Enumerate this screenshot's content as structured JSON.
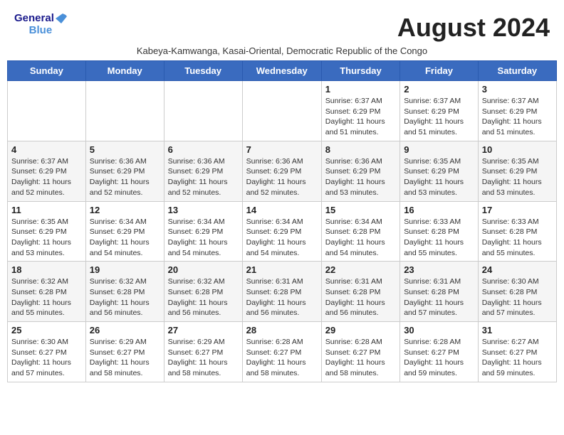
{
  "header": {
    "logo_general": "General",
    "logo_blue": "Blue",
    "month_year": "August 2024",
    "subtitle": "Kabeya-Kamwanga, Kasai-Oriental, Democratic Republic of the Congo"
  },
  "days_of_week": [
    "Sunday",
    "Monday",
    "Tuesday",
    "Wednesday",
    "Thursday",
    "Friday",
    "Saturday"
  ],
  "weeks": [
    [
      {
        "day": "",
        "info": ""
      },
      {
        "day": "",
        "info": ""
      },
      {
        "day": "",
        "info": ""
      },
      {
        "day": "",
        "info": ""
      },
      {
        "day": "1",
        "info": "Sunrise: 6:37 AM\nSunset: 6:29 PM\nDaylight: 11 hours and 51 minutes."
      },
      {
        "day": "2",
        "info": "Sunrise: 6:37 AM\nSunset: 6:29 PM\nDaylight: 11 hours and 51 minutes."
      },
      {
        "day": "3",
        "info": "Sunrise: 6:37 AM\nSunset: 6:29 PM\nDaylight: 11 hours and 51 minutes."
      }
    ],
    [
      {
        "day": "4",
        "info": "Sunrise: 6:37 AM\nSunset: 6:29 PM\nDaylight: 11 hours and 52 minutes."
      },
      {
        "day": "5",
        "info": "Sunrise: 6:36 AM\nSunset: 6:29 PM\nDaylight: 11 hours and 52 minutes."
      },
      {
        "day": "6",
        "info": "Sunrise: 6:36 AM\nSunset: 6:29 PM\nDaylight: 11 hours and 52 minutes."
      },
      {
        "day": "7",
        "info": "Sunrise: 6:36 AM\nSunset: 6:29 PM\nDaylight: 11 hours and 52 minutes."
      },
      {
        "day": "8",
        "info": "Sunrise: 6:36 AM\nSunset: 6:29 PM\nDaylight: 11 hours and 53 minutes."
      },
      {
        "day": "9",
        "info": "Sunrise: 6:35 AM\nSunset: 6:29 PM\nDaylight: 11 hours and 53 minutes."
      },
      {
        "day": "10",
        "info": "Sunrise: 6:35 AM\nSunset: 6:29 PM\nDaylight: 11 hours and 53 minutes."
      }
    ],
    [
      {
        "day": "11",
        "info": "Sunrise: 6:35 AM\nSunset: 6:29 PM\nDaylight: 11 hours and 53 minutes."
      },
      {
        "day": "12",
        "info": "Sunrise: 6:34 AM\nSunset: 6:29 PM\nDaylight: 11 hours and 54 minutes."
      },
      {
        "day": "13",
        "info": "Sunrise: 6:34 AM\nSunset: 6:29 PM\nDaylight: 11 hours and 54 minutes."
      },
      {
        "day": "14",
        "info": "Sunrise: 6:34 AM\nSunset: 6:29 PM\nDaylight: 11 hours and 54 minutes."
      },
      {
        "day": "15",
        "info": "Sunrise: 6:34 AM\nSunset: 6:28 PM\nDaylight: 11 hours and 54 minutes."
      },
      {
        "day": "16",
        "info": "Sunrise: 6:33 AM\nSunset: 6:28 PM\nDaylight: 11 hours and 55 minutes."
      },
      {
        "day": "17",
        "info": "Sunrise: 6:33 AM\nSunset: 6:28 PM\nDaylight: 11 hours and 55 minutes."
      }
    ],
    [
      {
        "day": "18",
        "info": "Sunrise: 6:32 AM\nSunset: 6:28 PM\nDaylight: 11 hours and 55 minutes."
      },
      {
        "day": "19",
        "info": "Sunrise: 6:32 AM\nSunset: 6:28 PM\nDaylight: 11 hours and 56 minutes."
      },
      {
        "day": "20",
        "info": "Sunrise: 6:32 AM\nSunset: 6:28 PM\nDaylight: 11 hours and 56 minutes."
      },
      {
        "day": "21",
        "info": "Sunrise: 6:31 AM\nSunset: 6:28 PM\nDaylight: 11 hours and 56 minutes."
      },
      {
        "day": "22",
        "info": "Sunrise: 6:31 AM\nSunset: 6:28 PM\nDaylight: 11 hours and 56 minutes."
      },
      {
        "day": "23",
        "info": "Sunrise: 6:31 AM\nSunset: 6:28 PM\nDaylight: 11 hours and 57 minutes."
      },
      {
        "day": "24",
        "info": "Sunrise: 6:30 AM\nSunset: 6:28 PM\nDaylight: 11 hours and 57 minutes."
      }
    ],
    [
      {
        "day": "25",
        "info": "Sunrise: 6:30 AM\nSunset: 6:27 PM\nDaylight: 11 hours and 57 minutes."
      },
      {
        "day": "26",
        "info": "Sunrise: 6:29 AM\nSunset: 6:27 PM\nDaylight: 11 hours and 58 minutes."
      },
      {
        "day": "27",
        "info": "Sunrise: 6:29 AM\nSunset: 6:27 PM\nDaylight: 11 hours and 58 minutes."
      },
      {
        "day": "28",
        "info": "Sunrise: 6:28 AM\nSunset: 6:27 PM\nDaylight: 11 hours and 58 minutes."
      },
      {
        "day": "29",
        "info": "Sunrise: 6:28 AM\nSunset: 6:27 PM\nDaylight: 11 hours and 58 minutes."
      },
      {
        "day": "30",
        "info": "Sunrise: 6:28 AM\nSunset: 6:27 PM\nDaylight: 11 hours and 59 minutes."
      },
      {
        "day": "31",
        "info": "Sunrise: 6:27 AM\nSunset: 6:27 PM\nDaylight: 11 hours and 59 minutes."
      }
    ]
  ]
}
